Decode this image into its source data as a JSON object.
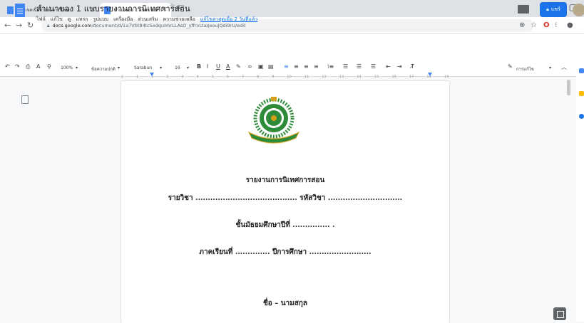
{
  "browser": {
    "tabs": [
      {
        "title": "ขอบเขตเนื้อหาและการนิเทศ...",
        "active": false
      },
      {
        "title": "สำเนาของ 1 แบบรายงานการนิเทศการ...",
        "active": true
      }
    ],
    "new_tab_icon": "plus-icon",
    "url_host": "docs.google.com",
    "url_path": "/document/d/1a7Vbt84tcSxdquImrLLAsO_yffrvLtaqxoujQdi9rU/edit"
  },
  "doc": {
    "title": "สำเนาของ 1 แบบรายงานการนิเทศการสอน",
    "menus": [
      "ไฟล์",
      "แก้ไข",
      "ดู",
      "แทรก",
      "รูปแบบ",
      "เครื่องมือ",
      "ส่วนเสริม",
      "ความช่วยเหลือ"
    ],
    "last_edit": "แก้ไขล่าสุดเมื่อ 2 วันที่แล้ว",
    "share_label": "แชร์"
  },
  "toolbar": {
    "zoom": "100%",
    "style": "ข้อความปกติ",
    "font": "Sarabun",
    "size": "16",
    "mode": "การแก้ไข"
  },
  "ruler": {
    "ticks": [
      "2",
      "1",
      "1",
      "2",
      "3",
      "4",
      "5",
      "6",
      "7",
      "8",
      "9",
      "10",
      "11",
      "12",
      "13",
      "14",
      "15",
      "16",
      "17",
      "18",
      "19"
    ]
  },
  "content": {
    "heading": "รายงานการนิเทศการสอน",
    "line_subject": "รายวิชา ......................................... รหัสวิชา ..............................",
    "line_grade": "ชั้นมัธยมศึกษาปีที่ ............... .",
    "line_term": "ภาคเรียนที่ .............. ปีการศึกษา .........................",
    "line_name": "ชื่อ – นามสกุล"
  },
  "colors": {
    "docs_blue": "#4285f4",
    "share_blue": "#1a73e8",
    "logo_green": "#2e8b3a",
    "logo_gold": "#d4a017"
  }
}
